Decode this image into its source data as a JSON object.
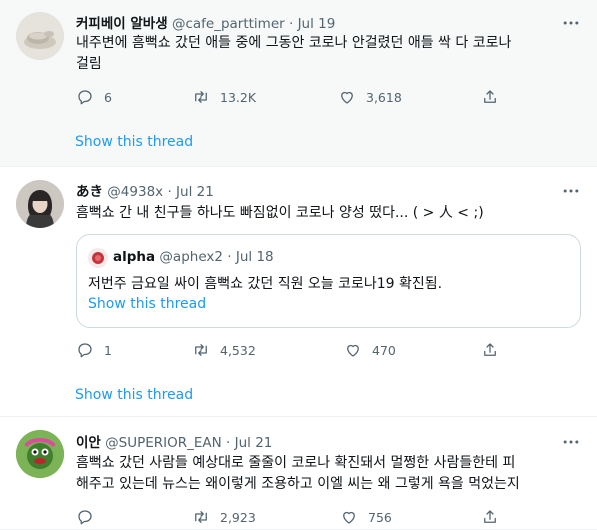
{
  "tweets": [
    {
      "name": "커피베이 알바생",
      "handle": "@cafe_parttimer",
      "dot": "·",
      "date": "Jul 19",
      "text_line1": "내주변에 흠뻑쇼 갔던 애들 중에 그동안 코로나 안걸렸던 애들 싹 다 코로나",
      "text_line2": "걸림",
      "replies": "6",
      "retweets": "13.2K",
      "likes": "3,618",
      "show_thread": "Show this thread"
    },
    {
      "name": "あき",
      "handle": "@4938x",
      "dot": "·",
      "date": "Jul 21",
      "text_line1": "흠뻑쇼 간 내 친구들 하나도 빠짐없이 코로나 양성 떴다... ( > 人 < ;)",
      "quote": {
        "name": "alpha",
        "handle": "@aphex2",
        "dot": "·",
        "date": "Jul 18",
        "text": "저번주 금요일 싸이 흠뻑쇼 갔던 직원 오늘 코로나19 확진됨.",
        "show_thread": "Show this thread"
      },
      "replies": "1",
      "retweets": "4,532",
      "likes": "470",
      "show_thread": "Show this thread"
    },
    {
      "name": "이안",
      "handle": "@SUPERIOR_EAN",
      "dot": "·",
      "date": "Jul 21",
      "text_line1": "흠뻑쇼 갔던 사람들 예상대로 줄줄이 코로나 확진돼서 멀쩡한 사람들한테 피",
      "text_line2": "해주고 있는데 뉴스는 왜이렇게 조용하고 이엘 씨는 왜 그렇게 욕을 먹었는지",
      "retweets": "2,923",
      "likes": "756"
    }
  ],
  "colors": {
    "link": "#1d9bf0",
    "secondary": "#536471",
    "primary": "#0f1419"
  }
}
